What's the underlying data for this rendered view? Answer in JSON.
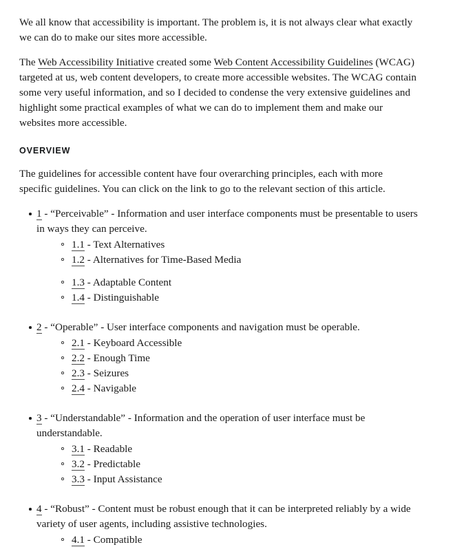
{
  "article": {
    "intro_paragraphs": [
      {
        "segments": [
          {
            "type": "text",
            "value": "We all know that accessibility is important. The problem is, it is not always clear what exactly we can do to make our sites more accessible."
          }
        ]
      },
      {
        "segments": [
          {
            "type": "text",
            "value": "The "
          },
          {
            "type": "link",
            "value": "Web Accessibility Initiative"
          },
          {
            "type": "text",
            "value": " created some "
          },
          {
            "type": "link",
            "value": "Web Content Accessibility Guidelines"
          },
          {
            "type": "text",
            "value": " (WCAG) targeted at us, web content developers, to create more accessible websites. The WCAG contain some very useful information, and so I decided to condense the very extensive guidelines and highlight some practical examples of what we can do to implement them and make our websites more accessible."
          }
        ]
      }
    ],
    "overview": {
      "heading": "OVERVIEW",
      "description": "The guidelines for accessible content have four overarching principles, each with more specific guidelines. You can click on the link to go to the relevant section of this article."
    },
    "principles": [
      {
        "number": "1",
        "title": "“Perceivable”",
        "description": " - Information and user interface components must be presentable to users in ways they can perceive.",
        "separator": " - ",
        "guideline_groups": [
          [
            {
              "number": "1.1",
              "separator": " - ",
              "title": "Text Alternatives"
            },
            {
              "number": "1.2",
              "separator": " - ",
              "title": "Alternatives for Time-Based Media"
            }
          ],
          [
            {
              "number": "1.3",
              "separator": " - ",
              "title": "Adaptable Content"
            },
            {
              "number": "1.4",
              "separator": " - ",
              "title": "Distinguishable"
            }
          ]
        ]
      },
      {
        "number": "2",
        "title": "“Operable”",
        "description": " - User interface components and navigation must be operable.",
        "separator": " - ",
        "guideline_groups": [
          [
            {
              "number": "2.1",
              "separator": " - ",
              "title": "Keyboard Accessible"
            },
            {
              "number": "2.2",
              "separator": " - ",
              "title": "Enough Time"
            },
            {
              "number": "2.3",
              "separator": " - ",
              "title": "Seizures"
            },
            {
              "number": "2.4",
              "separator": " - ",
              "title": "Navigable"
            }
          ]
        ]
      },
      {
        "number": "3",
        "title": "“Understandable”",
        "description": " - Information and the operation of user interface must be understandable.",
        "separator": " - ",
        "guideline_groups": [
          [
            {
              "number": "3.1",
              "separator": " - ",
              "title": "Readable"
            },
            {
              "number": "3.2",
              "separator": " - ",
              "title": "Predictable"
            },
            {
              "number": "3.3",
              "separator": " - ",
              "title": "Input Assistance"
            }
          ]
        ]
      },
      {
        "number": "4",
        "title": "“Robust”",
        "description": " - Content must be robust enough that it can be interpreted reliably by a wide variety of user agents, including assistive technologies.",
        "separator": " - ",
        "guideline_groups": [
          [
            {
              "number": "4.1",
              "separator": " - ",
              "title": "Compatible"
            }
          ]
        ]
      }
    ]
  },
  "colors": {
    "background": "#ffffff",
    "text": "#1a1a1a",
    "link_underline": "#4a4a4a",
    "heading": "#16181a"
  }
}
